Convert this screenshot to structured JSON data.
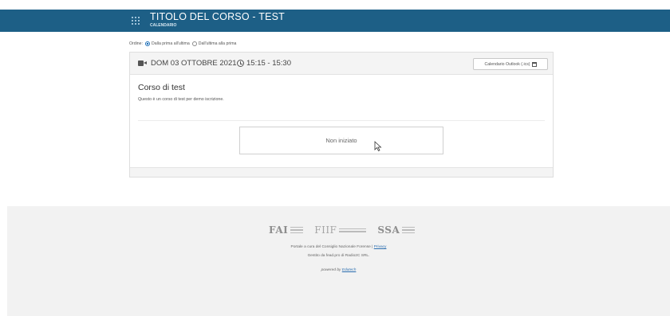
{
  "header": {
    "title": "TITOLO DEL CORSO - TEST",
    "subtitle": "CALENDARIO",
    "bg_color": "#1d5f86"
  },
  "order": {
    "label": "Ordine:",
    "options": [
      {
        "label": "Dalla prima all'ultima",
        "selected": true
      },
      {
        "label": "Dall'ultima alla prima",
        "selected": false
      }
    ]
  },
  "session": {
    "icon": "video-camera-icon",
    "date": "DOM 03 OTTOBRE 2021",
    "time": "15:15 - 15:30",
    "calendar_button": "Calendario Outlook (.ics)",
    "course_name": "Corso di test",
    "course_description": "Questo è un corso di test per demo iscrizione.",
    "status": "Non iniziato"
  },
  "footer": {
    "logos": [
      {
        "name": "fai-logo",
        "text": "FAI"
      },
      {
        "name": "fiif-logo",
        "text": "FIIF"
      },
      {
        "name": "ssa-logo",
        "text": "SSA"
      }
    ],
    "line1_text": "Portale a cura del Consiglio Nazionale Forense |",
    "privacy_link": "Privacy",
    "line2": "Gestito da fead.pro di Radio2C SRL.",
    "powered_text": "powered by",
    "powered_link": "Edutech"
  }
}
